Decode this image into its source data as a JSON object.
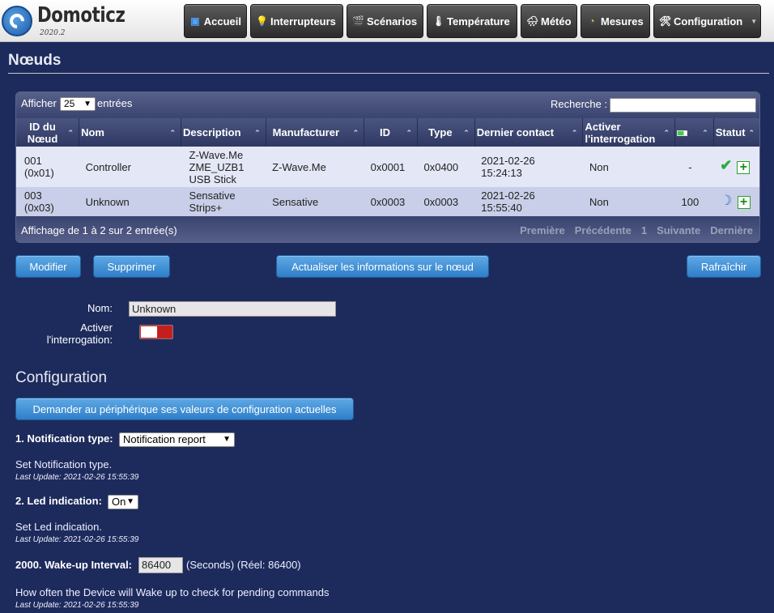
{
  "app": {
    "name": "Domoticz",
    "version": "2020.2"
  },
  "nav": [
    {
      "label": "Accueil",
      "icon": "home-icon",
      "glyph": "▣"
    },
    {
      "label": "Interrupteurs",
      "icon": "lightbulb-icon",
      "glyph": "💡"
    },
    {
      "label": "Scénarios",
      "icon": "clapperboard-icon",
      "glyph": "🎬"
    },
    {
      "label": "Température",
      "icon": "thermometer-icon",
      "glyph": "🌡"
    },
    {
      "label": "Météo",
      "icon": "weather-icon",
      "glyph": "🌧"
    },
    {
      "label": "Mesures",
      "icon": "gauge-icon",
      "glyph": "◔"
    },
    {
      "label": "Configuration",
      "icon": "tools-icon",
      "glyph": "🛠"
    }
  ],
  "page": {
    "title": "Nœuds"
  },
  "table": {
    "show_label": "Afficher",
    "show_value": "25",
    "entries_label": "entrées",
    "search_label": "Recherche :",
    "search_value": "",
    "headers": [
      "ID du Nœud",
      "Nom",
      "Description",
      "Manufacturer",
      "ID",
      "Type",
      "Dernier contact",
      "Activer l'interrogation",
      "",
      "Statut"
    ],
    "rows": [
      {
        "node": "001 (0x01)",
        "name": "Controller",
        "description": "Z-Wave.Me ZME_UZB1 USB Stick",
        "manufacturer": "Z-Wave.Me",
        "id": "0x0001",
        "type": "0x0400",
        "last_contact": "2021-02-26 15:24:13",
        "polling": "Non",
        "battery": "-",
        "status_icon": "check-icon",
        "status_glyph": "✔"
      },
      {
        "node": "003 (0x03)",
        "name": "Unknown",
        "description": "Sensative Strips+",
        "manufacturer": "Sensative",
        "id": "0x0003",
        "type": "0x0003",
        "last_contact": "2021-02-26 15:55:40",
        "polling": "Non",
        "battery": "100",
        "status_icon": "moon-icon",
        "status_glyph": "☽"
      }
    ],
    "info": "Affichage de 1 à 2 sur 2 entrée(s)",
    "pager": [
      "Première",
      "Précédente",
      "1",
      "Suivante",
      "Dernière"
    ]
  },
  "buttons": {
    "modify": "Modifier",
    "delete": "Supprimer",
    "refresh_node": "Actualiser les informations sur le nœud",
    "refresh": "Rafraîchir"
  },
  "form": {
    "name_label": "Nom:",
    "name_value": "Unknown",
    "polling_label": "Activer l'interrogation:"
  },
  "config": {
    "title": "Configuration",
    "request_button": "Demander au périphérique ses valeurs de configuration actuelles",
    "params": [
      {
        "label": "1. Notification type:",
        "value": "Notification report",
        "desc": "Set Notification type.",
        "updated": "Last Update: 2021-02-26 15:55:39"
      },
      {
        "label": "2. Led indication:",
        "value": "On",
        "desc": "Set Led indication.",
        "updated": "Last Update: 2021-02-26 15:55:39"
      },
      {
        "label": "2000. Wake-up Interval:",
        "value": "86400",
        "suffix": "(Seconds) (Réel: 86400)",
        "desc": "How often the Device will Wake up to check for pending commands",
        "updated": "Last Update: 2021-02-26 15:55:39"
      }
    ]
  }
}
